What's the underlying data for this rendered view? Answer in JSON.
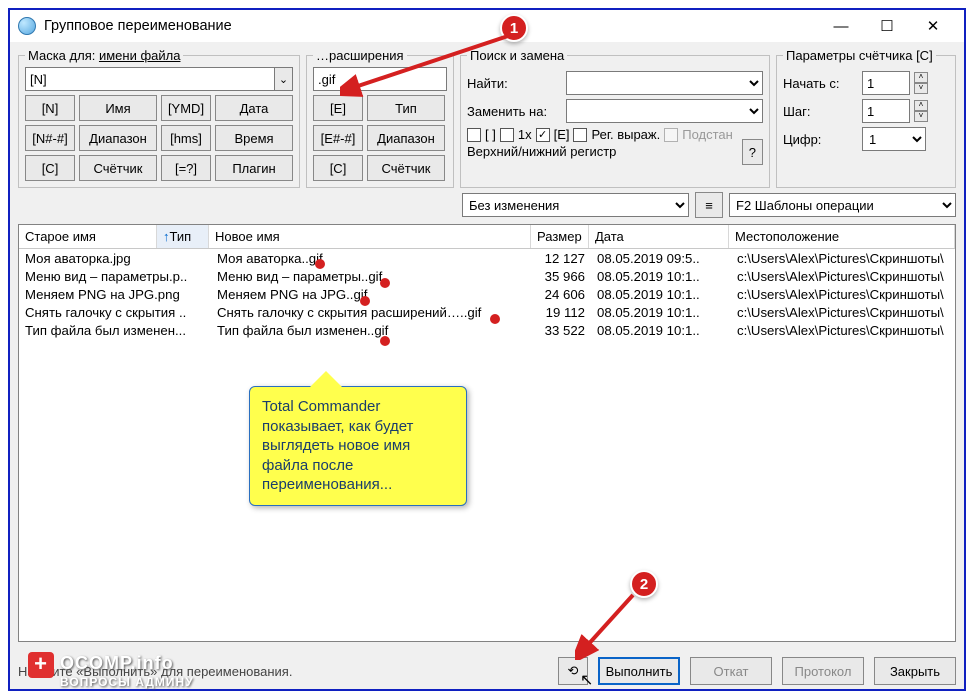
{
  "title": "Групповое переименование",
  "groups": {
    "name_mask": {
      "legend_prefix": "Маска для: ",
      "legend_link": "имени файла",
      "value": "[N]",
      "btn_n": "[N]",
      "btn_n_lbl": "Имя",
      "btn_ymd": "[YMD]",
      "btn_ymd_lbl": "Дата",
      "btn_range": "[N#-#]",
      "btn_range_lbl": "Диапазон",
      "btn_hms": "[hms]",
      "btn_hms_lbl": "Время",
      "btn_c": "[C]",
      "btn_c_lbl": "Счётчик",
      "btn_plugin": "[=?]",
      "btn_plugin_lbl": "Плагин"
    },
    "ext_mask": {
      "legend": "…расширения",
      "value": ".gif",
      "btn_e": "[E]",
      "btn_e_lbl": "Тип",
      "btn_range": "[E#-#]",
      "btn_range_lbl": "Диапазон",
      "btn_c": "[C]",
      "btn_c_lbl": "Счётчик"
    },
    "find": {
      "legend": "Поиск и замена",
      "find_lbl": "Найти:",
      "replace_lbl": "Заменить на:",
      "chk_brackets": "[ ]",
      "chk_1x": "1x",
      "chk_e": "[E]",
      "chk_regex": "Рег. выраж.",
      "chk_subst": "Подстан",
      "case_legend": "Верхний/нижний регистр",
      "case_value": "Без изменения",
      "help": "?"
    },
    "counter": {
      "legend": "Параметры счётчика [C]",
      "start_lbl": "Начать с:",
      "start_val": "1",
      "step_lbl": "Шаг:",
      "step_val": "1",
      "digits_lbl": "Цифр:",
      "digits_val": "1",
      "f2": "F2 Шаблоны операции"
    }
  },
  "table": {
    "headers": {
      "old": "Старое имя",
      "typ": "Тип",
      "new": "Новое имя",
      "size": "Размер",
      "date": "Дата",
      "loc": "Местоположение"
    },
    "sort_arrow": "↑",
    "rows": [
      {
        "old": "Моя аваторка.jpg",
        "new": "Моя аваторка..gif",
        "size": "12 127",
        "date": "08.05.2019 09:5..",
        "loc": "c:\\Users\\Alex\\Pictures\\Скриншоты\\"
      },
      {
        "old": "Меню вид – параметры.p..",
        "new": "Меню вид – параметры..gif",
        "size": "35 966",
        "date": "08.05.2019 10:1..",
        "loc": "c:\\Users\\Alex\\Pictures\\Скриншоты\\"
      },
      {
        "old": "Меняем PNG на JPG.png",
        "new": "Меняем PNG на JPG..gif",
        "size": "24 606",
        "date": "08.05.2019 10:1..",
        "loc": "c:\\Users\\Alex\\Pictures\\Скриншоты\\"
      },
      {
        "old": "Снять галочку с скрытия ..",
        "new": "Снять галочку с скрытия расширений…..gif",
        "size": "19 112",
        "date": "08.05.2019 10:1..",
        "loc": "c:\\Users\\Alex\\Pictures\\Скриншоты\\"
      },
      {
        "old": "Тип файла был изменен...",
        "new": "Тип файла был изменен..gif",
        "size": "33 522",
        "date": "08.05.2019 10:1..",
        "loc": "c:\\Users\\Alex\\Pictures\\Скриншоты\\"
      }
    ]
  },
  "footer": {
    "hint": "Нажмите «Выполнить» для переименования.",
    "reload": "⟲",
    "run": "Выполнить",
    "undo": "Откат",
    "log": "Протокол",
    "close": "Закрыть"
  },
  "callout": "Total Commander показывает, как будет выглядеть новое имя файла после переименования...",
  "badges": {
    "b1": "1",
    "b2": "2"
  },
  "watermark": {
    "plus": "+",
    "l1": "OCOMP.info",
    "l2": "ВОПРОСЫ АДМИНУ"
  }
}
